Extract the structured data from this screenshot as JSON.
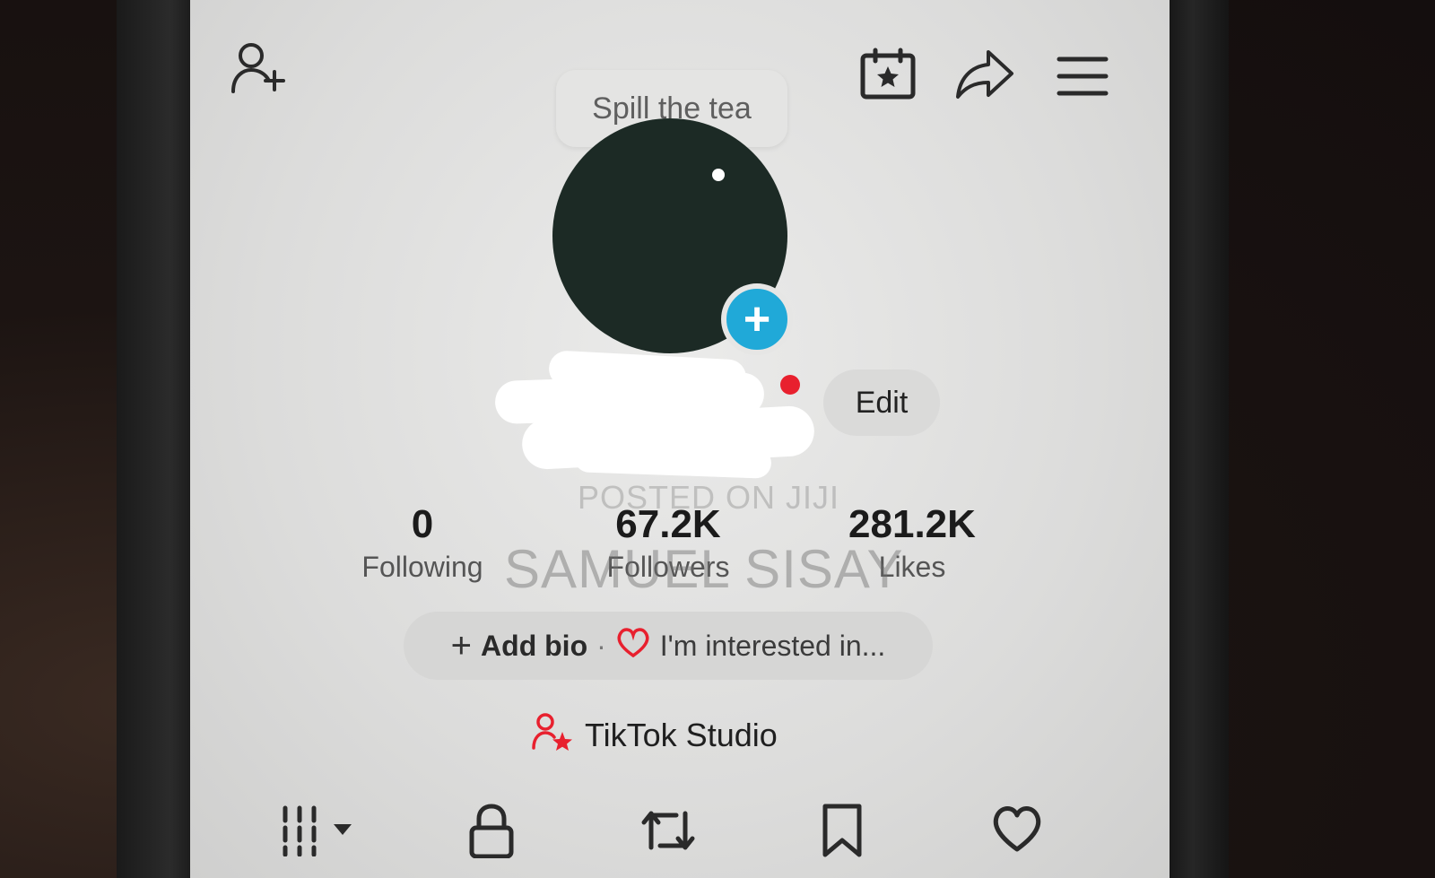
{
  "profile": {
    "tooltip": "Spill the tea",
    "edit_label": "Edit"
  },
  "stats": [
    {
      "value": "0",
      "label": "Following"
    },
    {
      "value": "67.2K",
      "label": "Followers"
    },
    {
      "value": "281.2K",
      "label": "Likes"
    }
  ],
  "bio": {
    "add_bio": "Add bio",
    "separator": "·",
    "interests": "I'm interested in..."
  },
  "studio": {
    "label": "TikTok Studio"
  },
  "watermark": {
    "line1": "POSTED ON JIJI",
    "line2": "SAMUEL SISAY"
  },
  "icons": {
    "top_left": "add-friend-icon",
    "top_right": [
      "calendar-star-icon",
      "share-icon",
      "menu-icon"
    ],
    "tabs": [
      "grid-icon",
      "lock-icon",
      "repost-icon",
      "bookmark-icon",
      "heart-icon"
    ]
  },
  "colors": {
    "accent_blue": "#20a9d8",
    "accent_red": "#e8202e"
  }
}
